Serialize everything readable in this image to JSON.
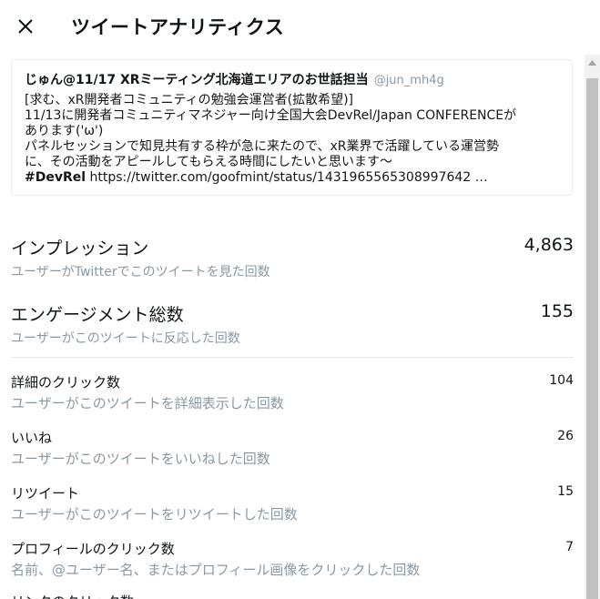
{
  "header": {
    "close_icon": "close-icon",
    "title": "ツイートアナリティクス"
  },
  "tweet": {
    "author_name": "じゅん@11/17 XRミーティング北海道エリアのお世話担当",
    "author_handle": "@jun_mh4g",
    "lines": [
      "[求む、xR開発者コミュニティの勉強会運営者(拡散希望)]",
      "11/13に開発者コミュニティマネジャー向け全国大会DevRel/Japan CONFERENCEが",
      "あります('ω')",
      "パネルセッションで知見共有する枠が急に来たので、xR業界で活躍している運営勢",
      "に、その活動をアピールしてもらえる時間にしたいと思います～"
    ],
    "hashtag": "#DevRel",
    "link": " https://twitter.com/goofmint/status/1431965565308997642 …"
  },
  "metrics": {
    "impressions": {
      "label": "インプレッション",
      "value": "4,863",
      "desc": "ユーザーがTwitterでこのツイートを見た回数"
    },
    "engagements": {
      "label": "エンゲージメント総数",
      "value": "155",
      "desc": "ユーザーがこのツイートに反応した回数"
    },
    "detail_clicks": {
      "label": "詳細のクリック数",
      "value": "104",
      "desc": "ユーザーがこのツイートを詳細表示した回数"
    },
    "likes": {
      "label": "いいね",
      "value": "26",
      "desc": "ユーザーがこのツイートをいいねした回数"
    },
    "retweets": {
      "label": "リツイート",
      "value": "15",
      "desc": "ユーザーがこのツイートをリツイートした回数"
    },
    "profile_clicks": {
      "label": "プロフィールのクリック数",
      "value": "7",
      "desc": "名前、@ユーザー名、またはプロフィール画像をクリックした回数"
    }
  },
  "next_label": "リンクのクリック数"
}
